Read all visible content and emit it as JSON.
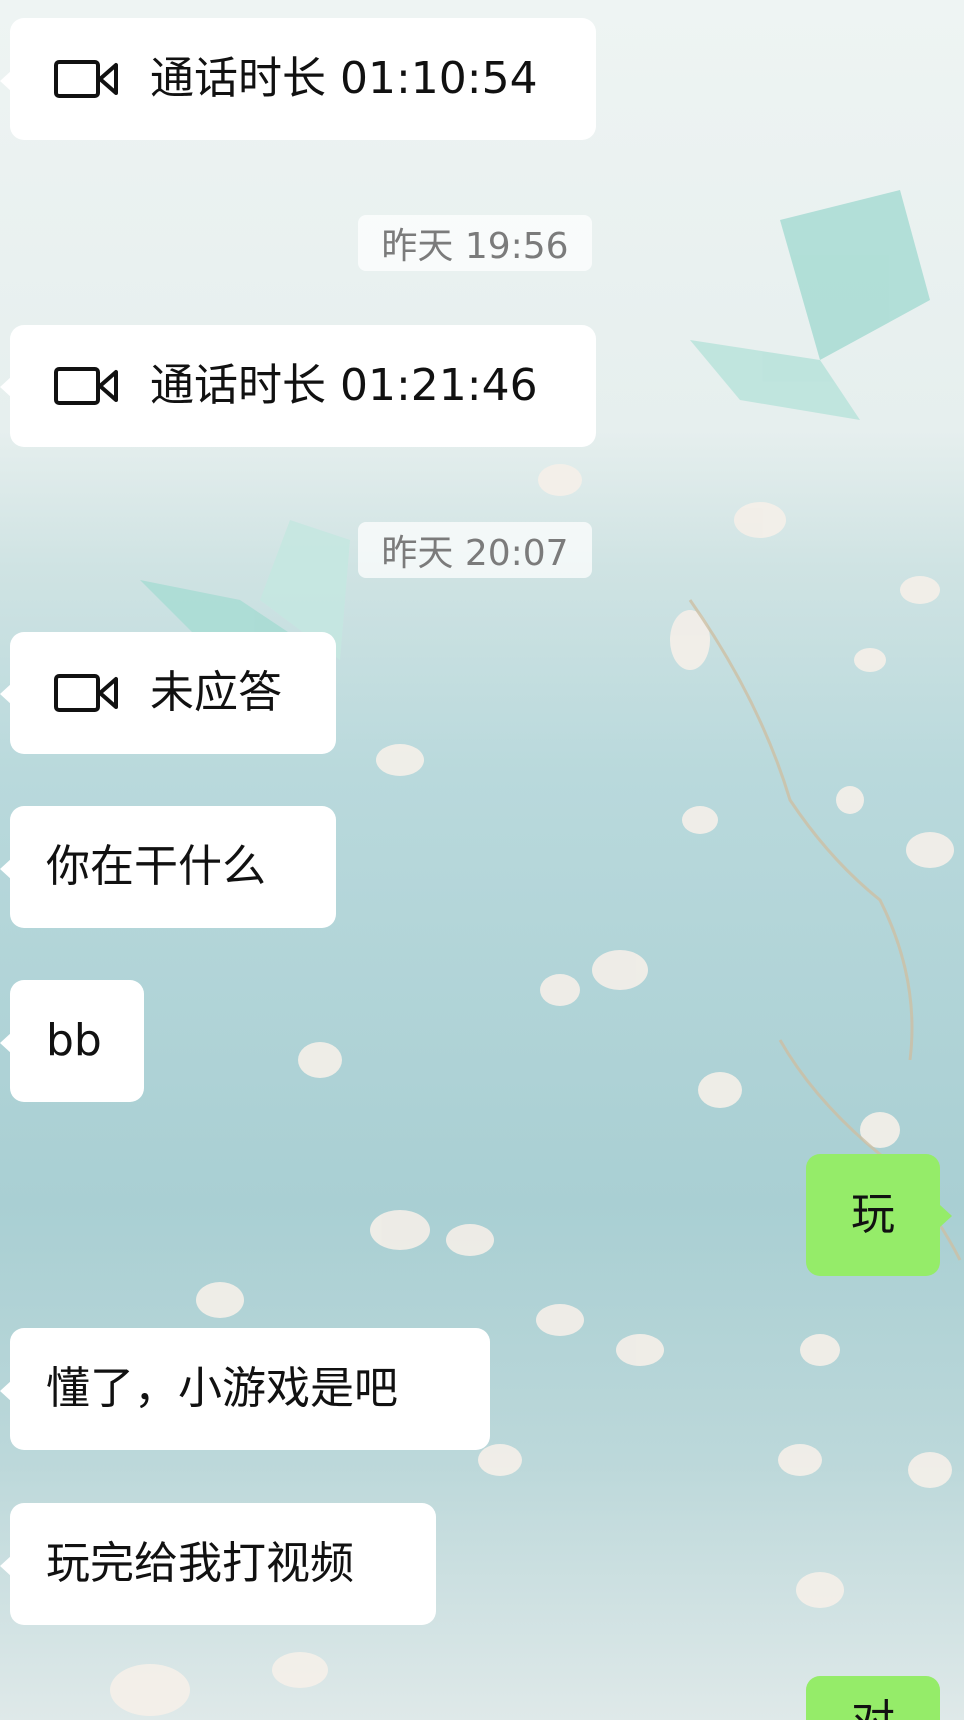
{
  "messages": {
    "call1": {
      "icon": "video-camera-icon",
      "text": "通话时长 01:10:54"
    },
    "ts1": "昨天 19:56",
    "call2": {
      "icon": "video-camera-icon",
      "text": "通话时长 01:21:46"
    },
    "ts2": "昨天 20:07",
    "call3": {
      "icon": "video-camera-icon",
      "text": "未应答"
    },
    "m1": "你在干什么",
    "m2": "bb",
    "m3": "玩",
    "m4": "懂了，小游戏是吧",
    "m5": "玩完给我打视频",
    "m6": "对"
  },
  "colors": {
    "incoming_bubble": "#ffffff",
    "outgoing_bubble": "#95ec69",
    "timestamp_text": "#7b7b7b"
  }
}
